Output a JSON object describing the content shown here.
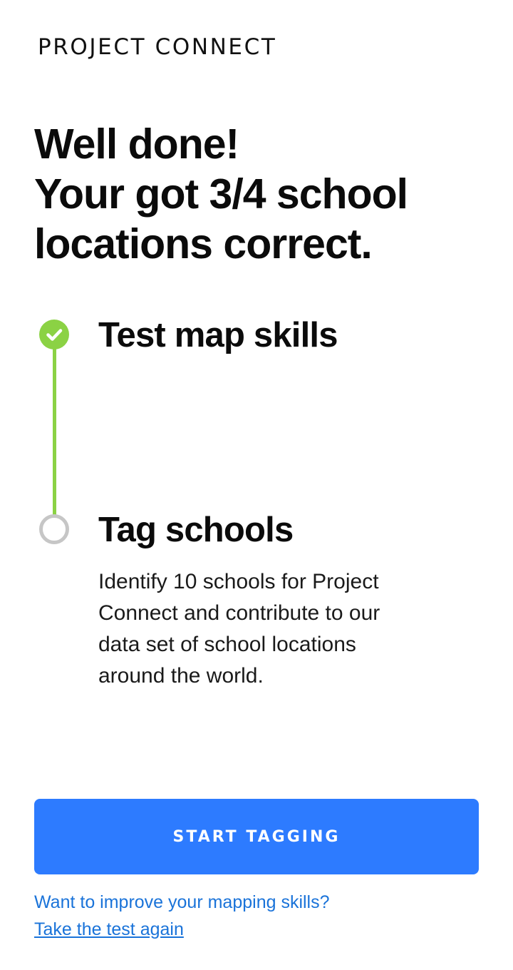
{
  "header": {
    "brand": "PROJECT CONNECT"
  },
  "result": {
    "line1": "Well done!",
    "line2": "Your got 3/4 school",
    "line3": "locations correct."
  },
  "steps": [
    {
      "title": "Test map skills",
      "status": "completed",
      "icon": "check-circle-icon"
    },
    {
      "title": "Tag schools",
      "status": "pending",
      "icon": "empty-circle-icon",
      "description": "Identify 10 schools for Project Connect and contribute to our data set of school locations around the world."
    }
  ],
  "actions": {
    "primary_label": "START TAGGING",
    "secondary_prompt": "Want to improve your mapping skills?",
    "secondary_link": "Take the test again"
  },
  "colors": {
    "accent_blue": "#2d7bff",
    "link_blue": "#1a73d9",
    "success_green": "#8bd244",
    "pending_gray": "#c6c6c6"
  }
}
